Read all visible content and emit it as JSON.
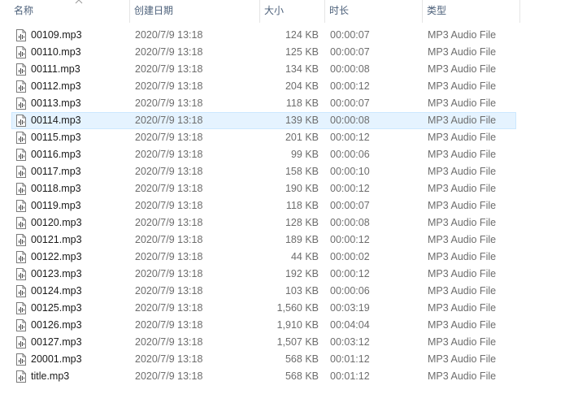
{
  "columns": {
    "name": "名称",
    "date": "创建日期",
    "size": "大小",
    "duration": "时长",
    "type": "类型"
  },
  "icons": {
    "file": "audio-file-icon",
    "sort": "sort-ascending-icon"
  },
  "colors": {
    "selected_bg": "#e5f3ff",
    "selected_border": "#cce8ff",
    "header_text": "#4c607a"
  },
  "files": [
    {
      "name": "00109.mp3",
      "date": "2020/7/9 13:18",
      "size": "124 KB",
      "duration": "00:00:07",
      "type": "MP3 Audio File"
    },
    {
      "name": "00110.mp3",
      "date": "2020/7/9 13:18",
      "size": "125 KB",
      "duration": "00:00:07",
      "type": "MP3 Audio File"
    },
    {
      "name": "00111.mp3",
      "date": "2020/7/9 13:18",
      "size": "134 KB",
      "duration": "00:00:08",
      "type": "MP3 Audio File"
    },
    {
      "name": "00112.mp3",
      "date": "2020/7/9 13:18",
      "size": "204 KB",
      "duration": "00:00:12",
      "type": "MP3 Audio File"
    },
    {
      "name": "00113.mp3",
      "date": "2020/7/9 13:18",
      "size": "118 KB",
      "duration": "00:00:07",
      "type": "MP3 Audio File"
    },
    {
      "name": "00114.mp3",
      "date": "2020/7/9 13:18",
      "size": "139 KB",
      "duration": "00:00:08",
      "type": "MP3 Audio File",
      "selected": true
    },
    {
      "name": "00115.mp3",
      "date": "2020/7/9 13:18",
      "size": "201 KB",
      "duration": "00:00:12",
      "type": "MP3 Audio File"
    },
    {
      "name": "00116.mp3",
      "date": "2020/7/9 13:18",
      "size": "99 KB",
      "duration": "00:00:06",
      "type": "MP3 Audio File"
    },
    {
      "name": "00117.mp3",
      "date": "2020/7/9 13:18",
      "size": "158 KB",
      "duration": "00:00:10",
      "type": "MP3 Audio File"
    },
    {
      "name": "00118.mp3",
      "date": "2020/7/9 13:18",
      "size": "190 KB",
      "duration": "00:00:12",
      "type": "MP3 Audio File"
    },
    {
      "name": "00119.mp3",
      "date": "2020/7/9 13:18",
      "size": "118 KB",
      "duration": "00:00:07",
      "type": "MP3 Audio File"
    },
    {
      "name": "00120.mp3",
      "date": "2020/7/9 13:18",
      "size": "128 KB",
      "duration": "00:00:08",
      "type": "MP3 Audio File"
    },
    {
      "name": "00121.mp3",
      "date": "2020/7/9 13:18",
      "size": "189 KB",
      "duration": "00:00:12",
      "type": "MP3 Audio File"
    },
    {
      "name": "00122.mp3",
      "date": "2020/7/9 13:18",
      "size": "44 KB",
      "duration": "00:00:02",
      "type": "MP3 Audio File"
    },
    {
      "name": "00123.mp3",
      "date": "2020/7/9 13:18",
      "size": "192 KB",
      "duration": "00:00:12",
      "type": "MP3 Audio File"
    },
    {
      "name": "00124.mp3",
      "date": "2020/7/9 13:18",
      "size": "103 KB",
      "duration": "00:00:06",
      "type": "MP3 Audio File"
    },
    {
      "name": "00125.mp3",
      "date": "2020/7/9 13:18",
      "size": "1,560 KB",
      "duration": "00:03:19",
      "type": "MP3 Audio File"
    },
    {
      "name": "00126.mp3",
      "date": "2020/7/9 13:18",
      "size": "1,910 KB",
      "duration": "00:04:04",
      "type": "MP3 Audio File"
    },
    {
      "name": "00127.mp3",
      "date": "2020/7/9 13:18",
      "size": "1,507 KB",
      "duration": "00:03:12",
      "type": "MP3 Audio File"
    },
    {
      "name": "20001.mp3",
      "date": "2020/7/9 13:18",
      "size": "568 KB",
      "duration": "00:01:12",
      "type": "MP3 Audio File"
    },
    {
      "name": "title.mp3",
      "date": "2020/7/9 13:18",
      "size": "568 KB",
      "duration": "00:01:12",
      "type": "MP3 Audio File"
    }
  ]
}
